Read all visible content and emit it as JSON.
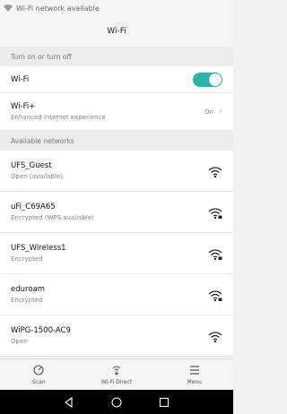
{
  "statusbar": {
    "notification": "Wi-Fi network available"
  },
  "header": {
    "title": "Wi-Fi"
  },
  "sections": {
    "toggle_header": "Turn on or turn off",
    "networks_header": "Available networks"
  },
  "wifi_toggle": {
    "label": "Wi-Fi",
    "state": "on"
  },
  "wifi_plus": {
    "label": "Wi-Fi+",
    "subtitle": "Enhanced Internet experience",
    "state": "On"
  },
  "networks": [
    {
      "name": "UFS_Guest",
      "status": "Open (available)",
      "locked": false
    },
    {
      "name": "uFi_C69A65",
      "status": "Encrypted (WPS available)",
      "locked": true
    },
    {
      "name": "UFS_Wireless1",
      "status": "Encrypted",
      "locked": true
    },
    {
      "name": "eduroam",
      "status": "Encrypted",
      "locked": true
    },
    {
      "name": "WiPG-1500-AC9",
      "status": "Open",
      "locked": false
    }
  ],
  "bottom_nav": {
    "scan": "Scan",
    "wifi_direct": "Wi-Fi Direct",
    "menu": "Menu"
  },
  "colors": {
    "accent": "#2bb5a8",
    "background": "#f2f2f2"
  },
  "icons": {
    "statusbar": "wifi-icon",
    "scan": "scan-icon",
    "wifi_direct": "wifi-direct-icon",
    "menu": "menu-icon",
    "back": "back-icon",
    "home": "home-icon",
    "recents": "recents-icon"
  }
}
